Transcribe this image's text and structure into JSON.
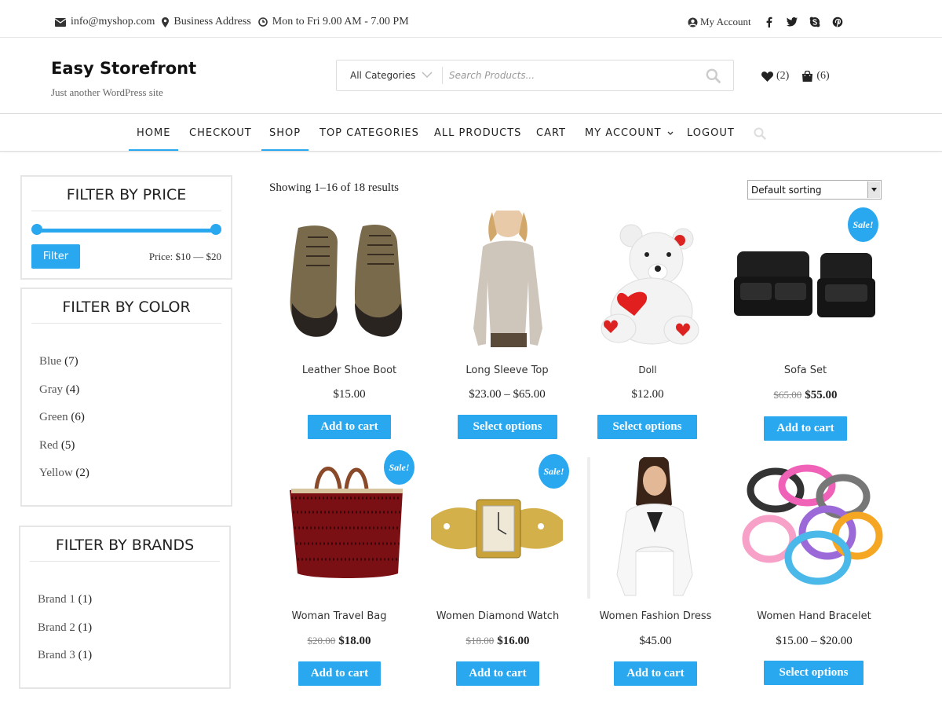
{
  "colors": {
    "accent": "#29a8f0",
    "text": "#333333"
  },
  "topbar": {
    "email": "info@myshop.com",
    "address": "Business Address",
    "hours": "Mon to Fri 9.00 AM - 7.00 PM",
    "account": "My Account",
    "social_icons": [
      "facebook-icon",
      "twitter-icon",
      "skype-icon",
      "pinterest-icon"
    ]
  },
  "header": {
    "site_title": "Easy Storefront",
    "tagline": "Just another WordPress site",
    "category_select": "All Categories",
    "search_placeholder": "Search Products...",
    "wishlist_count": "(2)",
    "cart_count": "(6)"
  },
  "nav": {
    "items": [
      "HOME",
      "CHECKOUT",
      "SHOP",
      "TOP CATEGORIES",
      "ALL PRODUCTS",
      "CART",
      "MY ACCOUNT",
      "LOGOUT"
    ]
  },
  "sidebar": {
    "price": {
      "title": "FILTER BY PRICE",
      "button": "Filter",
      "label": "Price: $10 — $20",
      "range_min_fraction": 0,
      "range_max_fraction": 1
    },
    "color": {
      "title": "FILTER BY COLOR",
      "items": [
        {
          "name": "Blue",
          "count": "(7)"
        },
        {
          "name": "Gray",
          "count": "(4)"
        },
        {
          "name": "Green",
          "count": "(6)"
        },
        {
          "name": "Red",
          "count": "(5)"
        },
        {
          "name": "Yellow",
          "count": "(2)"
        }
      ]
    },
    "brands": {
      "title": "FILTER BY BRANDS",
      "items": [
        {
          "name": "Brand 1",
          "count": "(1)"
        },
        {
          "name": "Brand 2",
          "count": "(1)"
        },
        {
          "name": "Brand 3",
          "count": "(1)"
        }
      ]
    }
  },
  "main": {
    "result_count": "Showing 1–16 of 18 results",
    "sorting": "Default sorting",
    "sale_badge": "Sale!",
    "products": [
      {
        "name": "Leather Shoe Boot",
        "price": "$15.00",
        "old_price": "",
        "button": "Add to cart",
        "sale": false
      },
      {
        "name": "Long Sleeve Top",
        "price": "$23.00 – $65.00",
        "old_price": "",
        "button": "Select options",
        "sale": false
      },
      {
        "name": "Doll",
        "price": "$12.00",
        "old_price": "",
        "button": "Select options",
        "sale": false
      },
      {
        "name": "Sofa Set",
        "price": "$55.00",
        "old_price": "$65.00",
        "button": "Add to cart",
        "sale": true
      },
      {
        "name": "Woman Travel Bag",
        "price": "$18.00",
        "old_price": "$20.00",
        "button": "Add to cart",
        "sale": true
      },
      {
        "name": "Women Diamond Watch",
        "price": "$16.00",
        "old_price": "$18.00",
        "button": "Add to cart",
        "sale": true
      },
      {
        "name": "Women Fashion Dress",
        "price": "$45.00",
        "old_price": "",
        "button": "Add to cart",
        "sale": false
      },
      {
        "name": "Women Hand Bracelet",
        "price": "$15.00 – $20.00",
        "old_price": "",
        "button": "Select options",
        "sale": false
      }
    ]
  }
}
